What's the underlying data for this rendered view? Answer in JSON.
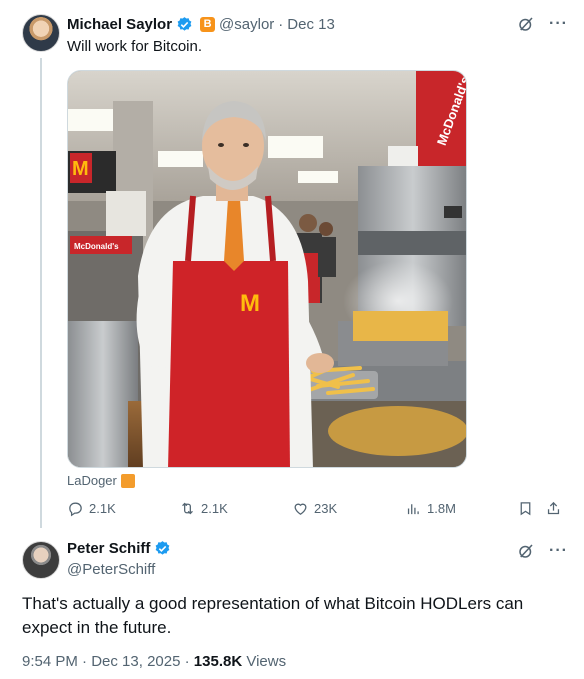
{
  "tweet1": {
    "display_name": "Michael Saylor",
    "handle": "@saylor",
    "separator": "·",
    "date": "Dec 13",
    "badge_letter": "B",
    "text": "Will work for Bitcoin.",
    "image_caption": "LaDoger",
    "image_text": {
      "sign_right": "McDonald's",
      "sign_left": "McDonald's",
      "logo": "M"
    },
    "actions": {
      "replies": "2.1K",
      "reposts": "2.1K",
      "likes": "23K",
      "views": "1.8M"
    }
  },
  "tweet2": {
    "display_name": "Peter Schiff",
    "handle": "@PeterSchiff",
    "text": "That's actually a good representation of what Bitcoin HODLers can expect in the future.",
    "time": "9:54 PM",
    "date": "Dec 13, 2025",
    "separator": "·",
    "views_count": "135.8K",
    "views_label": "Views"
  },
  "icons": {
    "more": "···"
  },
  "colors": {
    "verified": "#1d9bf0",
    "muted": "#536471",
    "btc_orange": "#f7931a",
    "mcd_red": "#d6262a",
    "mcd_yellow": "#ffbc0d"
  }
}
